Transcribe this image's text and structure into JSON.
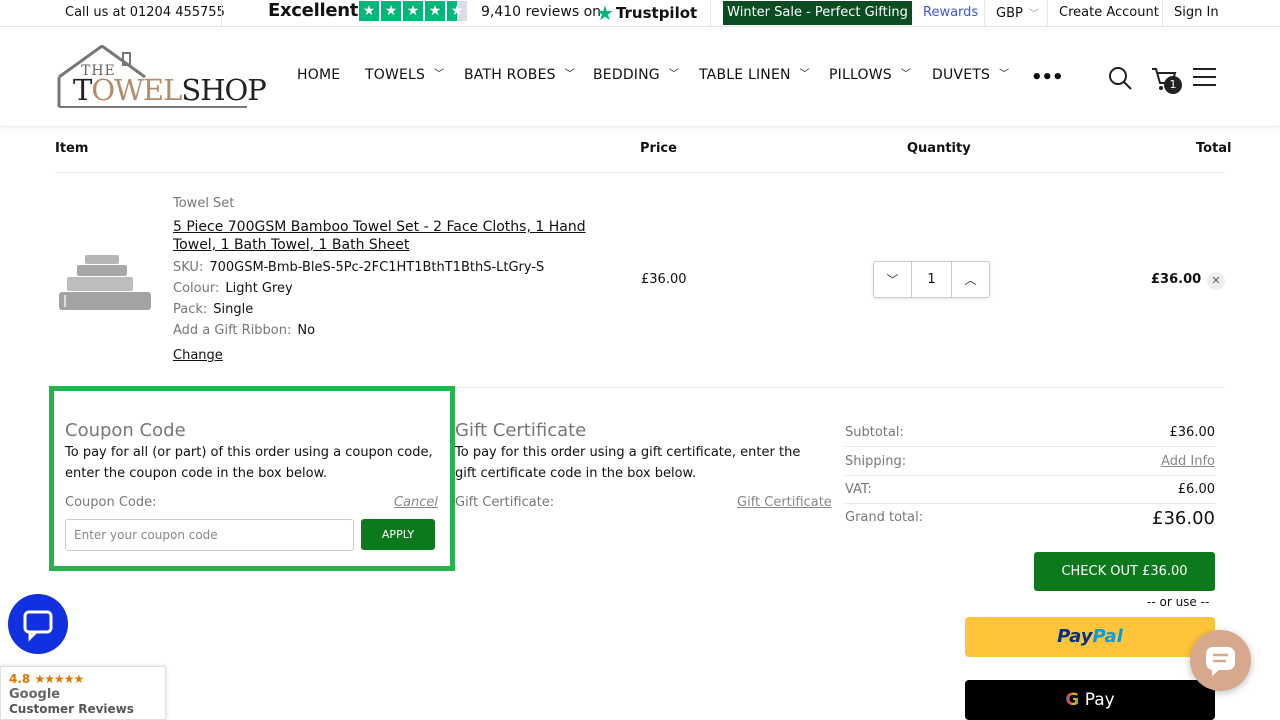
{
  "topbar": {
    "phone": "Call us at 01204 455755",
    "trustpilot_rating": "Excellent",
    "reviews": "9,410 reviews on",
    "trustpilot_brand": "Trustpilot",
    "sale_banner": "Winter Sale - Perfect Gifting >",
    "rewards": "Rewards",
    "currency": "GBP",
    "create_account": "Create Account",
    "sign_in": "Sign In"
  },
  "logo": {
    "the": "THE",
    "main_1": "T",
    "main_2": "OWEL",
    "main_3": "SHOP"
  },
  "nav": {
    "items": [
      "HOME",
      "TOWELS",
      "BATH ROBES",
      "BEDDING",
      "TABLE LINEN",
      "PILLOWS",
      "DUVETS"
    ],
    "more": "•••",
    "cart_count": "1"
  },
  "cart": {
    "headers": {
      "item": "Item",
      "price": "Price",
      "quantity": "Quantity",
      "total": "Total"
    },
    "item": {
      "category": "Towel Set",
      "name": "5 Piece 700GSM Bamboo Towel Set - 2 Face Cloths, 1 Hand Towel, 1 Bath Towel, 1 Bath Sheet",
      "options": [
        {
          "k": "SKU:",
          "v": "700GSM-Bmb-BleS-5Pc-2FC1HT1BthT1BthS-LtGry-S"
        },
        {
          "k": "Colour:",
          "v": "Light Grey"
        },
        {
          "k": "Pack:",
          "v": "Single"
        },
        {
          "k": "Add a Gift Ribbon:",
          "v": "No"
        }
      ],
      "change": "Change",
      "price": "£36.00",
      "quantity": "1",
      "total": "£36.00"
    }
  },
  "coupon": {
    "title": "Coupon Code",
    "description": "To pay for all (or part) of this order using a coupon code, enter the coupon code in the box below.",
    "label": "Coupon Code:",
    "cancel": "Cancel",
    "placeholder": "Enter your coupon code",
    "apply": "APPLY"
  },
  "gift": {
    "title": "Gift Certificate",
    "description": "To pay for this order using a gift certificate, enter the gift certificate code in the box below.",
    "label": "Gift Certificate:",
    "link": "Gift Certificate"
  },
  "summary": {
    "subtotal_label": "Subtotal:",
    "subtotal": "£36.00",
    "shipping_label": "Shipping:",
    "shipping": "Add Info",
    "vat_label": "VAT:",
    "vat": "£6.00",
    "grand_label": "Grand total:",
    "grand": "£36.00",
    "checkout": "CHECK OUT £36.00",
    "or_use": "-- or use --",
    "paypal_1": "Pay",
    "paypal_2": "Pal",
    "gpay_g": "G",
    "gpay": " Pay"
  },
  "google_reviews": {
    "rating": "4.8",
    "stars": "★★★★★",
    "brand": "Google",
    "label": "Customer Reviews"
  },
  "colors": {
    "accent_green": "#0c7a1c",
    "highlight": "#25b34b",
    "chat_blue": "#1130e0",
    "rewards_blue": "#3d55d6"
  }
}
